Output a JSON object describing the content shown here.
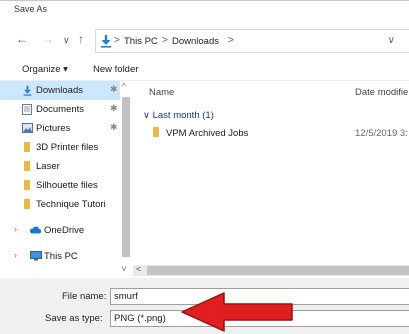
{
  "window": {
    "title": "Save As"
  },
  "nav": {
    "back_icon": "arrow-left-icon",
    "forward_icon": "arrow-right-icon",
    "recent_icon": "chevron-down-icon",
    "up_icon": "arrow-up-icon",
    "breadcrumb": [
      "This PC",
      "Downloads"
    ],
    "separator": ">"
  },
  "toolbar": {
    "organize_label": "Organize ▾",
    "new_folder_label": "New folder"
  },
  "sidebar": {
    "items": [
      {
        "label": "Downloads",
        "icon": "download-icon",
        "pinned": true,
        "selected": true
      },
      {
        "label": "Documents",
        "icon": "document-icon",
        "pinned": true
      },
      {
        "label": "Pictures",
        "icon": "pictures-icon",
        "pinned": true
      },
      {
        "label": "3D Printer files",
        "icon": "folder-icon"
      },
      {
        "label": "Laser",
        "icon": "folder-icon"
      },
      {
        "label": "Silhouette files",
        "icon": "folder-icon"
      },
      {
        "label": "Technique Tutori",
        "icon": "folder-icon"
      },
      {
        "label": "OneDrive",
        "icon": "cloud-icon",
        "expandable": true
      },
      {
        "label": "This PC",
        "icon": "computer-icon",
        "expandable": true
      }
    ]
  },
  "file_list": {
    "columns": [
      "Name",
      "Date modifie"
    ],
    "group_label": "Last month (1)",
    "rows": [
      {
        "name": "VPM Archived Jobs",
        "date": "12/5/2019 3:"
      }
    ]
  },
  "form": {
    "file_name_label": "File name:",
    "file_name_value": "smurf",
    "save_type_label": "Save as type:",
    "save_type_value": "PNG (*.png)"
  },
  "colors": {
    "selection": "#cce8ff",
    "folder": "#e8b84a",
    "annotation_arrow": "#e02020",
    "group_header": "#1e3287"
  }
}
